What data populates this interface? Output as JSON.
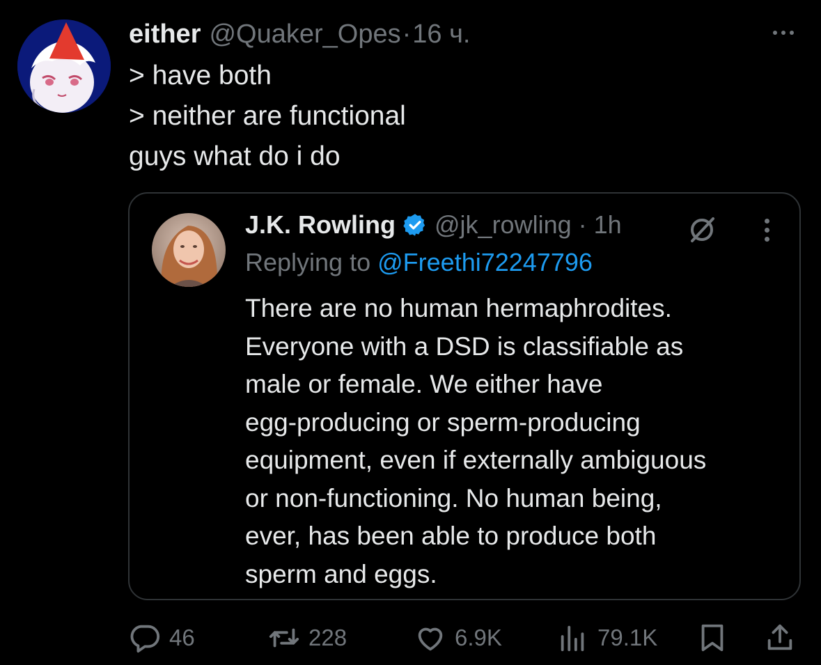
{
  "tweet": {
    "author_name": "either",
    "handle": "@Quaker_Opes",
    "separator": "·",
    "time": "16 ч.",
    "lines": [
      "> have both",
      "> neither are functional",
      "guys what do i do"
    ]
  },
  "quote": {
    "author_name": "J.K. Rowling",
    "handle": "@jk_rowling",
    "separator": "·",
    "time": "1h",
    "replying_prefix": "Replying to",
    "replying_to": "@Freethi72247796",
    "lines": [
      "There are no human hermaphrodites.",
      "Everyone with a DSD is classifiable as",
      "male or female. We either have",
      "egg-producing or sperm-producing",
      "equipment, even if externally ambiguous",
      "or non-functioning. No human being,",
      "ever, has been able to produce both",
      "sperm and eggs."
    ]
  },
  "actions": {
    "replies": "46",
    "reposts": "228",
    "likes": "6.9K",
    "views": "79.1K"
  },
  "colors": {
    "background": "#000000",
    "text": "#e7e9ea",
    "muted": "#71767b",
    "link": "#1d9bf0",
    "border": "#2f3336"
  },
  "icons": [
    "reply-icon",
    "repost-icon",
    "like-icon",
    "views-icon",
    "bookmark-icon",
    "share-icon",
    "verified-badge-icon",
    "grok-icon",
    "more-icon"
  ]
}
